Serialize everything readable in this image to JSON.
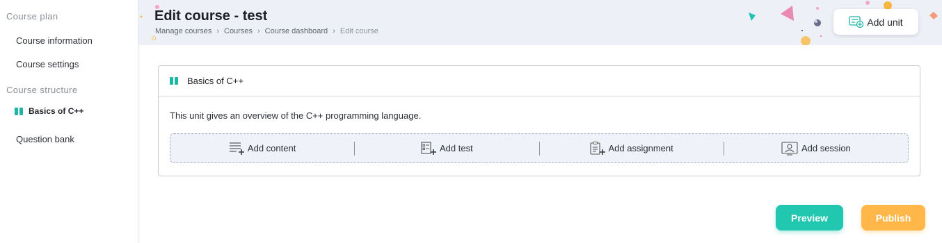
{
  "sidebar": {
    "section_course_plan": "Course plan",
    "item_course_information": "Course information",
    "item_course_settings": "Course settings",
    "section_course_structure": "Course structure",
    "unit_basics": "Basics of C++",
    "item_question_bank": "Question bank"
  },
  "header": {
    "title": "Edit course - test",
    "breadcrumb": [
      "Manage courses",
      "Courses",
      "Course dashboard",
      "Edit course"
    ],
    "add_unit_label": "Add unit"
  },
  "unit": {
    "title": "Basics of C++",
    "description": "This unit gives an overview of the C++ programming language.",
    "actions": {
      "add_content": "Add content",
      "add_test": "Add test",
      "add_assignment": "Add assignment",
      "add_session": "Add session"
    }
  },
  "footer": {
    "preview_label": "Preview",
    "publish_label": "Publish"
  },
  "colors": {
    "accent_teal": "#22c7b0",
    "accent_orange": "#ffb74a",
    "header_bg": "#eef0f7"
  }
}
